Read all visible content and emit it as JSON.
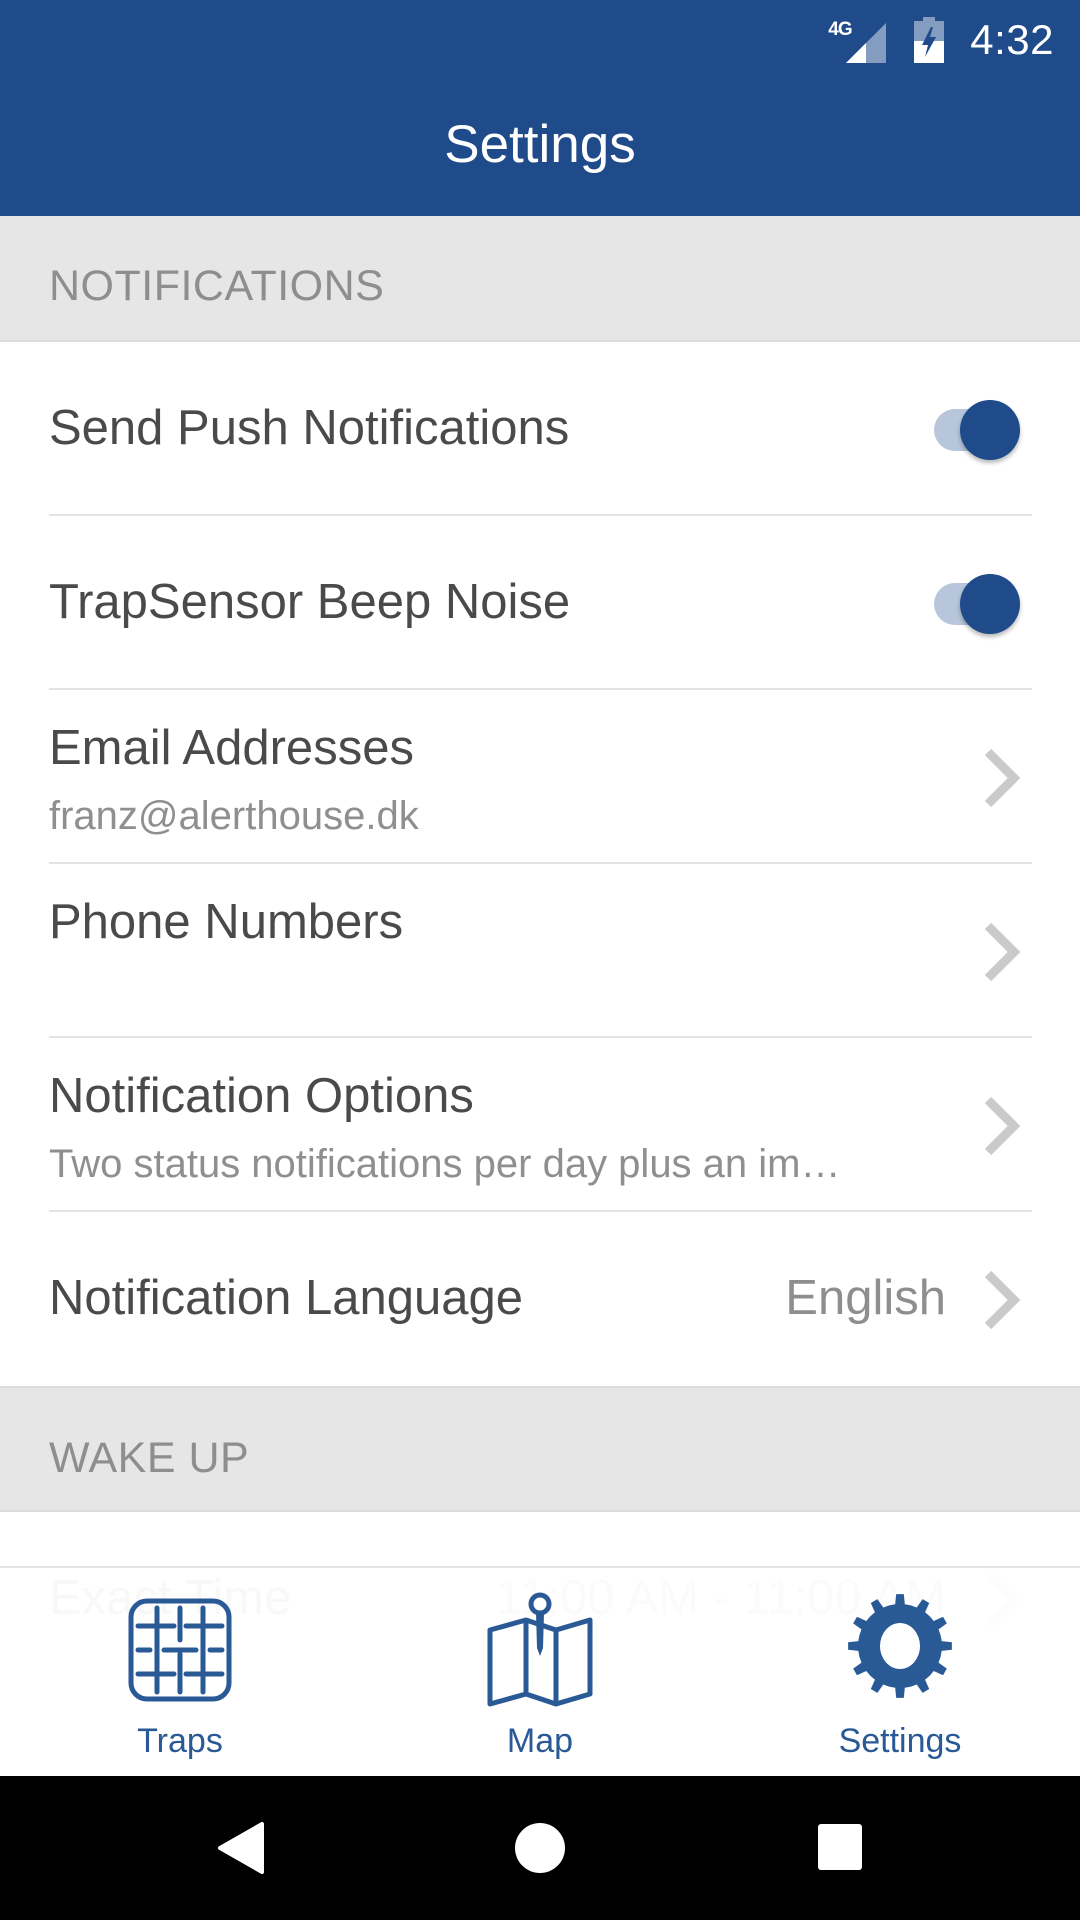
{
  "status_bar": {
    "network": "4G",
    "time": "4:32",
    "icons": [
      "signal-icon",
      "battery-charging-icon"
    ]
  },
  "app_bar": {
    "title": "Settings"
  },
  "sections": [
    {
      "header": "NOTIFICATIONS",
      "rows": [
        {
          "title": "Send Push Notifications",
          "type": "toggle",
          "on": true
        },
        {
          "title": "TrapSensor Beep Noise",
          "type": "toggle",
          "on": true
        },
        {
          "title": "Email Addresses",
          "subtitle": "franz@alerthouse.dk",
          "type": "link"
        },
        {
          "title": "Phone Numbers",
          "type": "link"
        },
        {
          "title": "Notification Options",
          "subtitle": "Two status notifications per day plus an im…",
          "type": "link"
        },
        {
          "title": "Notification Language",
          "value": "English",
          "type": "link"
        }
      ]
    },
    {
      "header": "WAKE UP",
      "rows": [
        {
          "title": "Exact Time",
          "value": "11:00 AM - 11:00 AM",
          "type": "link"
        }
      ]
    }
  ],
  "tabs": [
    {
      "label": "Traps",
      "icon": "grid-icon",
      "active": false
    },
    {
      "label": "Map",
      "icon": "map-pin-icon",
      "active": false
    },
    {
      "label": "Settings",
      "icon": "gear-icon",
      "active": true
    }
  ],
  "nav_bar": [
    "back",
    "home",
    "recents"
  ],
  "colors": {
    "primary": "#1F4B8A",
    "toggle_track": "#B7C6DA",
    "section_bg": "#E6E6E6",
    "title_text": "#4A4A4A",
    "secondary_text": "#8F8F8F",
    "tab_label": "#2A5A96"
  }
}
